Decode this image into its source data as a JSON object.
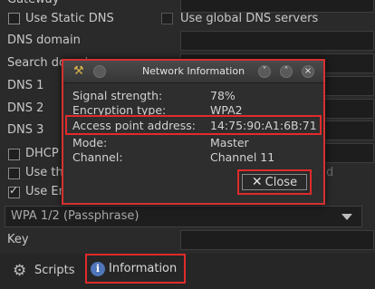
{
  "background": {
    "gateway_label": "Gateway",
    "use_static_dns_label": "Use Static DNS",
    "use_global_dns_label": "Use global DNS servers",
    "dns_domain_label": "DNS domain",
    "search_domain_label": "Search domain",
    "dns1_label": "DNS 1",
    "dns2_label": "DNS 2",
    "dns3_label": "DNS 3",
    "dhcp_label": "DHCP H",
    "use_the_label": "Use the",
    "use_enc_label": "Use Enc",
    "faded_d": "d",
    "encryption_combo_value": "WPA 1/2 (Passphrase)",
    "key_label": "Key",
    "scripts_label": "Scripts",
    "information_label": "Information"
  },
  "dialog": {
    "title": "Network Information",
    "rows": [
      {
        "key": "Signal strength:",
        "value": "78%"
      },
      {
        "key": "Encryption type:",
        "value": "WPA2"
      },
      {
        "key": "Access point address:",
        "value": "14:75:90:A1:6B:71"
      },
      {
        "key": "Mode:",
        "value": "Master"
      },
      {
        "key": "Channel:",
        "value": "Channel 11"
      }
    ],
    "close_label": "Close",
    "minimize_symbol": "˅",
    "maximize_symbol": "˄",
    "close_symbol": "×"
  },
  "colors": {
    "highlight": "#e02b2b",
    "info_icon": "#4f76b8"
  }
}
